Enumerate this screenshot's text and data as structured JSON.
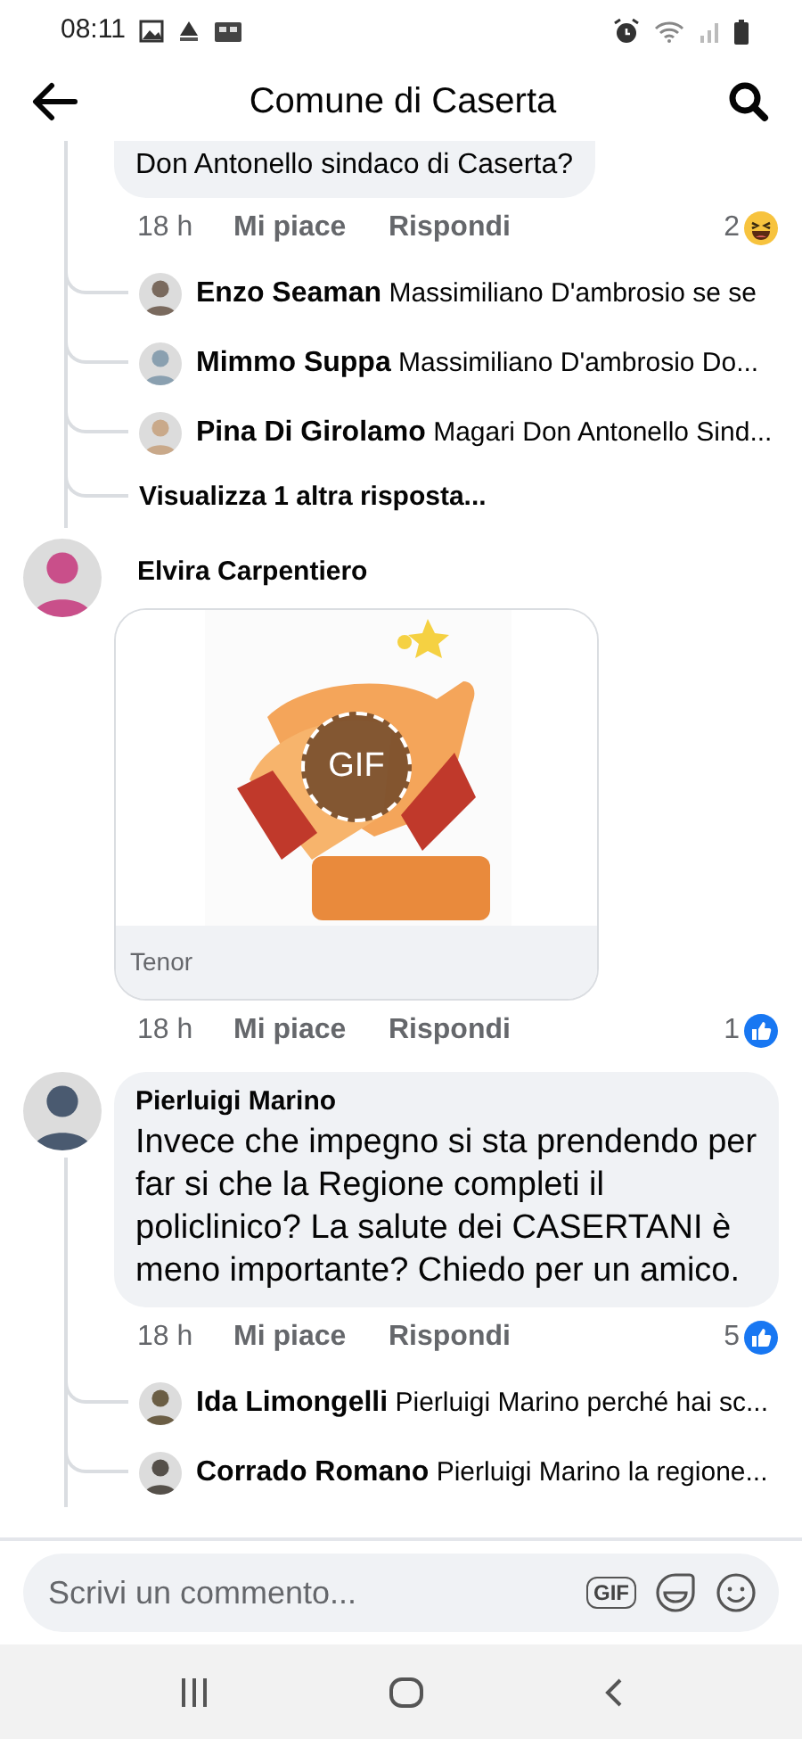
{
  "status_bar": {
    "time": "08:11"
  },
  "header": {
    "title": "Comune di Caserta"
  },
  "comments": [
    {
      "kind": "text",
      "text": "Don Antonello sindaco di Caserta?",
      "time": "18 h",
      "like_label": "Mi piace",
      "reply_label": "Rispondi",
      "reaction": {
        "kind": "haha",
        "count": "2"
      },
      "replies": [
        {
          "author": "Enzo Seaman",
          "text": "Massimiliano D'ambrosio se se"
        },
        {
          "author": "Mimmo Suppa",
          "text": "Massimiliano D'ambrosio Do..."
        },
        {
          "author": "Pina Di Girolamo",
          "text": "Magari Don Antonello Sind..."
        }
      ],
      "more_replies": "Visualizza 1 altra risposta..."
    },
    {
      "kind": "gif",
      "author": "Elvira Carpentiero",
      "gif_badge": "GIF",
      "source": "Tenor",
      "time": "18 h",
      "like_label": "Mi piace",
      "reply_label": "Rispondi",
      "reaction": {
        "kind": "like",
        "count": "1"
      }
    },
    {
      "kind": "text",
      "author": "Pierluigi Marino",
      "text": "Invece che impegno si sta prendendo per far si che la Regione completi il policlinico? La salute dei CASERTANI è meno importante? Chiedo per un amico.",
      "time": "18 h",
      "like_label": "Mi piace",
      "reply_label": "Rispondi",
      "reaction": {
        "kind": "like",
        "count": "5"
      },
      "replies": [
        {
          "author": "Ida Limongelli",
          "text": "Pierluigi Marino perché hai sc..."
        },
        {
          "author": "Corrado Romano",
          "text": "Pierluigi Marino la regione..."
        }
      ]
    }
  ],
  "composer": {
    "placeholder": "Scrivi un commento...",
    "gif_button": "GIF"
  }
}
